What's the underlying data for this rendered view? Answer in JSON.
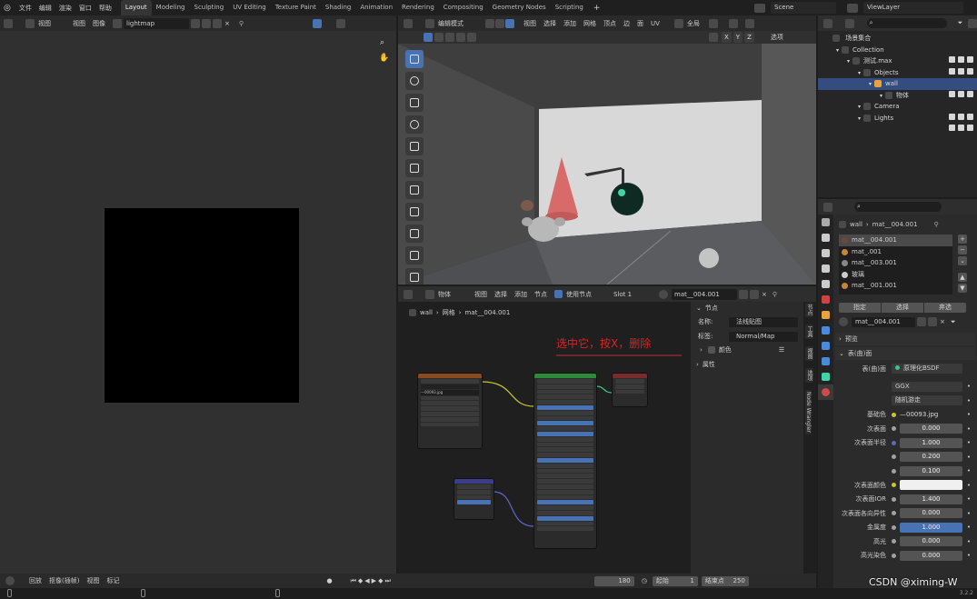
{
  "topbar": {
    "menus": [
      "文件",
      "编辑",
      "渲染",
      "窗口",
      "帮助"
    ],
    "workspaces": [
      "Layout",
      "Modeling",
      "Sculpting",
      "UV Editing",
      "Texture Paint",
      "Shading",
      "Animation",
      "Rendering",
      "Compositing",
      "Geometry Nodes",
      "Scripting"
    ],
    "add_tab": "+",
    "scene": "Scene",
    "view_layer": "ViewLayer"
  },
  "image_editor": {
    "view": "视图",
    "menu_view": "视图",
    "menu_image": "图像",
    "image_name": "lightmap"
  },
  "viewport": {
    "mode": "编辑模式",
    "menus": [
      "视图",
      "选择",
      "添加",
      "网格",
      "顶点",
      "边",
      "面",
      "UV"
    ],
    "orientation": "全局",
    "axes": [
      "X",
      "Y",
      "Z"
    ],
    "options": "选项"
  },
  "node_editor": {
    "object": "物体",
    "menus": [
      "视图",
      "选择",
      "添加",
      "节点"
    ],
    "use_nodes": "使用节点",
    "slot": "Slot 1",
    "material": "mat__004.001",
    "breadcrumb": [
      "wall",
      "网格",
      "mat__004.001"
    ],
    "annotation": "选中它，按X，删除",
    "image_node_file": "—00093.jpg",
    "panel": {
      "header": "节点",
      "name_label": "名称:",
      "name_value": "法线贴图",
      "label_label": "标签:",
      "label_value": "Normal/Map",
      "color_label": "颜色",
      "props_label": "属性"
    },
    "side_tabs": [
      "节点",
      "工具",
      "视图",
      "选项",
      "Node Wrangler"
    ]
  },
  "timeline": {
    "playback": "回放",
    "keying": "抠像(插帧)",
    "view": "视图",
    "markers": "标记",
    "frame": "180",
    "start_label": "起始",
    "start": "1",
    "end_label": "结束点",
    "end": "250"
  },
  "outliner": {
    "root": "场景集合",
    "items": [
      {
        "label": "Collection",
        "indent": 1
      },
      {
        "label": "测试.max",
        "indent": 2
      },
      {
        "label": "Objects",
        "indent": 3
      },
      {
        "label": "wall",
        "indent": 4,
        "selected": true
      },
      {
        "label": "物体",
        "indent": 5
      },
      {
        "label": "Camera",
        "indent": 3
      },
      {
        "label": "Lights",
        "indent": 3
      }
    ]
  },
  "properties": {
    "object": "wall",
    "material": "mat__004.001",
    "material_slots": [
      "mat__004.001",
      "mat_.001",
      "mat__003.001",
      "玻璃",
      "mat__001.001"
    ],
    "assign": "指定",
    "select": "选择",
    "deselect": "弃选",
    "preview": "预览",
    "surface_panel": "表(曲)面",
    "surface_label": "表(曲)面",
    "shader": "原理化BSDF",
    "distribution": "GGX",
    "subsurface_method": "随机游走",
    "rows": [
      {
        "label": "基础色",
        "value": "—00093.jpg",
        "kind": "link"
      },
      {
        "label": "次表面",
        "value": "0.000",
        "kind": "field"
      },
      {
        "label": "次表面半径",
        "value": "1.000",
        "kind": "field"
      },
      {
        "label": "",
        "value": "0.200",
        "kind": "field"
      },
      {
        "label": "",
        "value": "0.100",
        "kind": "field"
      },
      {
        "label": "次表面颜色",
        "value": "",
        "kind": "white"
      },
      {
        "label": "次表面IOR",
        "value": "1.400",
        "kind": "field"
      },
      {
        "label": "次表面各向异性",
        "value": "0.000",
        "kind": "field"
      },
      {
        "label": "金属度",
        "value": "1.000",
        "kind": "blue"
      },
      {
        "label": "高光",
        "value": "0.000",
        "kind": "field"
      },
      {
        "label": "高光染色",
        "value": "0.000",
        "kind": "field"
      }
    ]
  },
  "statusbar": {
    "version": "3.2.2"
  },
  "watermark": "CSDN @ximing-W"
}
